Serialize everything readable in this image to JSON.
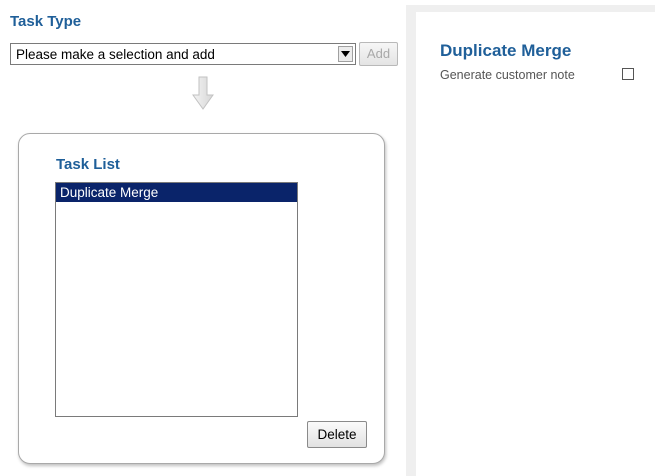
{
  "task_type": {
    "title": "Task Type",
    "select_value": "Please make a selection and add",
    "add_label": "Add",
    "add_enabled": false
  },
  "task_list": {
    "title": "Task List",
    "items": [
      "Duplicate Merge"
    ],
    "selected_index": 0,
    "delete_label": "Delete"
  },
  "detail": {
    "title": "Duplicate Merge",
    "note_label": "Generate customer note",
    "note_checked": false
  },
  "colors": {
    "heading": "#1f5f99",
    "selection": "#0a246a"
  },
  "icons": {
    "select_arrow": "triangle-down-icon",
    "flow_arrow": "arrow-down-icon"
  }
}
